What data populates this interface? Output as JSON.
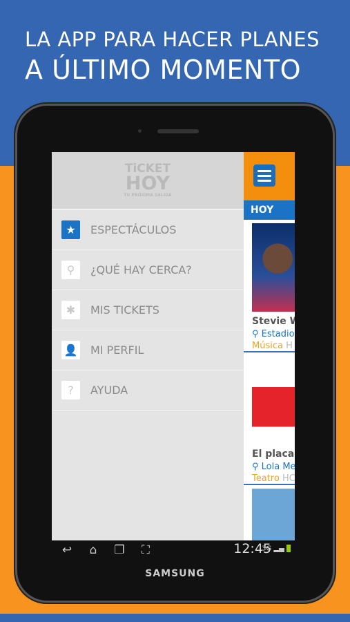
{
  "headline": {
    "line1": "LA APP PARA HACER PLANES",
    "line2": "A ÚLTIMO MOMENTO"
  },
  "logo": {
    "line1": "TiCKET",
    "line2": "HOY",
    "tagline": "TU PRÓXIMA SALIDA"
  },
  "drawer": {
    "items": [
      {
        "label": "ESPECTÁCULOS",
        "icon": "star-icon",
        "glyph": "★",
        "active": true
      },
      {
        "label": "¿QUÉ HAY CERCA?",
        "icon": "location-pin-icon",
        "glyph": "⚲"
      },
      {
        "label": "MIS TICKETS",
        "icon": "ticket-icon",
        "glyph": "✱"
      },
      {
        "label": "MI PERFIL",
        "icon": "person-icon",
        "glyph": "👤"
      },
      {
        "label": "AYUDA",
        "icon": "question-icon",
        "glyph": "?"
      }
    ]
  },
  "content": {
    "tab": "HOY",
    "cards": [
      {
        "title": "Stevie Wo",
        "venue": "Estadio",
        "category": "Música",
        "time": "H"
      },
      {
        "title": "El placard",
        "venue": "Lola Me",
        "category": "Teatro",
        "time": "HC"
      },
      {
        "title": "",
        "venue": "",
        "category": "",
        "time": ""
      }
    ]
  },
  "status": {
    "time": "12:45",
    "network": "3G"
  },
  "brand": "SAMSUNG",
  "colors": {
    "blue": "#3566b1",
    "orange": "#f7931e",
    "accent": "#1a73c4"
  }
}
